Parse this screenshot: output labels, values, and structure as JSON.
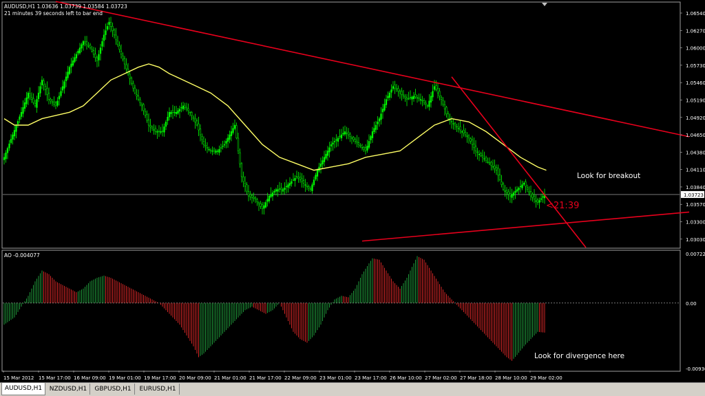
{
  "header": {
    "ohlc": "AUDUSD,H1  1.03636 1.03739 1.03584 1.03723",
    "timer": "21 minutes 39 seconds left to bar end"
  },
  "colors": {
    "candle": "#00ff00",
    "ma": "#ffff66",
    "trendline": "#e8001c",
    "ao_up": "#1f9a3a",
    "ao_down": "#d42626",
    "grid": "#c0c0c0"
  },
  "annotations": {
    "breakout": "Look for breakout",
    "divergence": "Look for divergence here",
    "countdown": "<21:39"
  },
  "chart_data": [
    {
      "type": "candlestick",
      "symbol": "AUDUSD,H1",
      "ylim": [
        1.029,
        1.067
      ],
      "yticks": [
        "1.06540",
        "1.06270",
        "1.06000",
        "1.05730",
        "1.05460",
        "1.05190",
        "1.04920",
        "1.04650",
        "1.04380",
        "1.04110",
        "1.03840",
        "1.03570",
        "1.03300",
        "1.03030"
      ],
      "current_price": "1.03723",
      "x_ticks": [
        "15 Mar 2012",
        "15 Mar 17:00",
        "16 Mar 09:00",
        "19 Mar 01:00",
        "19 Mar 17:00",
        "20 Mar 09:00",
        "21 Mar 01:00",
        "21 Mar 17:00",
        "22 Mar 09:00",
        "23 Mar 01:00",
        "23 Mar 17:00",
        "26 Mar 10:00",
        "27 Mar 02:00",
        "27 Mar 18:00",
        "28 Mar 10:00",
        "29 Mar 02:00"
      ],
      "close_anchors": [
        [
          0,
          1.043
        ],
        [
          5,
          1.0465
        ],
        [
          10,
          1.05
        ],
        [
          14,
          1.053
        ],
        [
          18,
          1.051
        ],
        [
          22,
          1.055
        ],
        [
          26,
          1.052
        ],
        [
          30,
          1.051
        ],
        [
          34,
          1.054
        ],
        [
          38,
          1.057
        ],
        [
          42,
          1.059
        ],
        [
          46,
          1.061
        ],
        [
          50,
          1.06
        ],
        [
          54,
          1.058
        ],
        [
          58,
          1.062
        ],
        [
          61,
          1.064
        ],
        [
          64,
          1.062
        ],
        [
          68,
          1.059
        ],
        [
          72,
          1.056
        ],
        [
          76,
          1.053
        ],
        [
          80,
          1.051
        ],
        [
          84,
          1.048
        ],
        [
          88,
          1.047
        ],
        [
          92,
          1.047
        ],
        [
          96,
          1.05
        ],
        [
          100,
          1.05
        ],
        [
          104,
          1.051
        ],
        [
          108,
          1.05
        ],
        [
          112,
          1.048
        ],
        [
          116,
          1.045
        ],
        [
          120,
          1.044
        ],
        [
          124,
          1.044
        ],
        [
          128,
          1.045
        ],
        [
          132,
          1.047
        ],
        [
          134,
          1.048
        ],
        [
          138,
          1.04
        ],
        [
          142,
          1.037
        ],
        [
          146,
          1.0365
        ],
        [
          150,
          1.035
        ],
        [
          154,
          1.037
        ],
        [
          158,
          1.038
        ],
        [
          162,
          1.038
        ],
        [
          166,
          1.039
        ],
        [
          170,
          1.04
        ],
        [
          174,
          1.039
        ],
        [
          178,
          1.038
        ],
        [
          182,
          1.041
        ],
        [
          186,
          1.043
        ],
        [
          190,
          1.045
        ],
        [
          194,
          1.046
        ],
        [
          198,
          1.047
        ],
        [
          202,
          1.046
        ],
        [
          206,
          1.045
        ],
        [
          210,
          1.044
        ],
        [
          214,
          1.047
        ],
        [
          218,
          1.049
        ],
        [
          222,
          1.052
        ],
        [
          226,
          1.054
        ],
        [
          230,
          1.053
        ],
        [
          234,
          1.052
        ],
        [
          238,
          1.0525
        ],
        [
          242,
          1.052
        ],
        [
          246,
          1.051
        ],
        [
          250,
          1.054
        ],
        [
          254,
          1.052
        ],
        [
          258,
          1.049
        ],
        [
          262,
          1.048
        ],
        [
          266,
          1.047
        ],
        [
          270,
          1.046
        ],
        [
          274,
          1.044
        ],
        [
          278,
          1.043
        ],
        [
          282,
          1.042
        ],
        [
          286,
          1.041
        ],
        [
          290,
          1.038
        ],
        [
          294,
          1.037
        ],
        [
          298,
          1.038
        ],
        [
          302,
          1.039
        ],
        [
          306,
          1.037
        ],
        [
          310,
          1.036
        ],
        [
          314,
          1.03723
        ]
      ],
      "moving_average": {
        "values": [
          [
            0,
            1.049
          ],
          [
            6,
            1.048
          ],
          [
            14,
            1.048
          ],
          [
            22,
            1.049
          ],
          [
            30,
            1.0495
          ],
          [
            38,
            1.05
          ],
          [
            46,
            1.051
          ],
          [
            54,
            1.053
          ],
          [
            62,
            1.055
          ],
          [
            70,
            1.056
          ],
          [
            78,
            1.057
          ],
          [
            84,
            1.0575
          ],
          [
            90,
            1.057
          ],
          [
            96,
            1.056
          ],
          [
            104,
            1.055
          ],
          [
            112,
            1.054
          ],
          [
            120,
            1.053
          ],
          [
            130,
            1.051
          ],
          [
            140,
            1.048
          ],
          [
            150,
            1.045
          ],
          [
            160,
            1.043
          ],
          [
            170,
            1.042
          ],
          [
            180,
            1.041
          ],
          [
            190,
            1.0415
          ],
          [
            200,
            1.042
          ],
          [
            210,
            1.043
          ],
          [
            220,
            1.0435
          ],
          [
            230,
            1.044
          ],
          [
            240,
            1.046
          ],
          [
            250,
            1.048
          ],
          [
            260,
            1.049
          ],
          [
            270,
            1.0485
          ],
          [
            280,
            1.047
          ],
          [
            290,
            1.045
          ],
          [
            300,
            1.043
          ],
          [
            310,
            1.0415
          ],
          [
            315,
            1.041
          ]
        ]
      },
      "trendlines": [
        {
          "from": [
            30,
            1.0672
          ],
          "to": [
            398,
            1.0462
          ]
        },
        {
          "from": [
            208,
            1.03
          ],
          "to": [
            398,
            1.0345
          ]
        },
        {
          "from": [
            260,
            1.0555
          ],
          "to": [
            338,
            1.029
          ]
        }
      ]
    },
    {
      "type": "bar",
      "indicator_label": "AO -0.004077",
      "ylim": [
        -0.00936,
        0.00722
      ],
      "yticks": [
        "0.00722",
        "0.00",
        "-0.00936"
      ],
      "zero_line": 0,
      "value_anchors": [
        [
          0,
          -0.003
        ],
        [
          6,
          -0.002
        ],
        [
          10,
          -0.0005
        ],
        [
          14,
          0.001
        ],
        [
          18,
          0.003
        ],
        [
          22,
          0.0045
        ],
        [
          26,
          0.004
        ],
        [
          30,
          0.003
        ],
        [
          34,
          0.0025
        ],
        [
          38,
          0.002
        ],
        [
          42,
          0.0015
        ],
        [
          46,
          0.002
        ],
        [
          50,
          0.003
        ],
        [
          54,
          0.0035
        ],
        [
          58,
          0.0038
        ],
        [
          62,
          0.0035
        ],
        [
          66,
          0.003
        ],
        [
          70,
          0.0025
        ],
        [
          74,
          0.002
        ],
        [
          78,
          0.0015
        ],
        [
          82,
          0.001
        ],
        [
          86,
          0.0005
        ],
        [
          90,
          0.0
        ],
        [
          94,
          -0.001
        ],
        [
          98,
          -0.002
        ],
        [
          102,
          -0.003
        ],
        [
          106,
          -0.0045
        ],
        [
          110,
          -0.006
        ],
        [
          113,
          -0.0075
        ],
        [
          116,
          -0.007
        ],
        [
          120,
          -0.006
        ],
        [
          124,
          -0.005
        ],
        [
          128,
          -0.004
        ],
        [
          132,
          -0.003
        ],
        [
          136,
          -0.002
        ],
        [
          140,
          -0.001
        ],
        [
          144,
          -0.0005
        ],
        [
          148,
          -0.001
        ],
        [
          152,
          -0.0015
        ],
        [
          156,
          -0.001
        ],
        [
          160,
          0.0
        ],
        [
          164,
          -0.002
        ],
        [
          168,
          -0.004
        ],
        [
          172,
          -0.005
        ],
        [
          176,
          -0.0055
        ],
        [
          180,
          -0.0045
        ],
        [
          184,
          -0.003
        ],
        [
          188,
          -0.001
        ],
        [
          192,
          0.0005
        ],
        [
          196,
          0.001
        ],
        [
          200,
          0.0008
        ],
        [
          204,
          0.002
        ],
        [
          208,
          0.004
        ],
        [
          212,
          0.0055
        ],
        [
          214,
          0.0062
        ],
        [
          218,
          0.006
        ],
        [
          222,
          0.0045
        ],
        [
          226,
          0.003
        ],
        [
          230,
          0.002
        ],
        [
          234,
          0.0035
        ],
        [
          238,
          0.0055
        ],
        [
          240,
          0.0065
        ],
        [
          244,
          0.006
        ],
        [
          248,
          0.0045
        ],
        [
          252,
          0.003
        ],
        [
          256,
          0.0015
        ],
        [
          260,
          0.0005
        ],
        [
          264,
          -0.0005
        ],
        [
          268,
          -0.0015
        ],
        [
          272,
          -0.0025
        ],
        [
          276,
          -0.0035
        ],
        [
          280,
          -0.0045
        ],
        [
          284,
          -0.0055
        ],
        [
          288,
          -0.0065
        ],
        [
          292,
          -0.0075
        ],
        [
          295,
          -0.008
        ],
        [
          298,
          -0.0072
        ],
        [
          302,
          -0.006
        ],
        [
          306,
          -0.005
        ],
        [
          310,
          -0.004
        ],
        [
          314,
          -0.0041
        ]
      ]
    }
  ],
  "tabs": [
    {
      "label": "AUDUSD,H1",
      "active": true
    },
    {
      "label": "NZDUSD,H1",
      "active": false
    },
    {
      "label": "GBPUSD,H1",
      "active": false
    },
    {
      "label": "EURUSD,H1",
      "active": false
    }
  ]
}
